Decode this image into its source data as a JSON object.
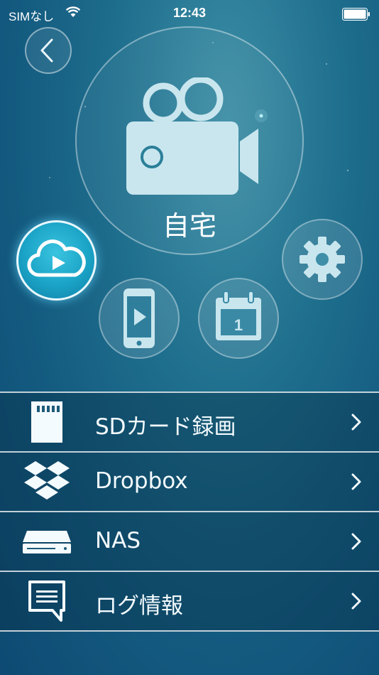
{
  "status_bar": {
    "carrier": "SIMなし",
    "time": "12:43",
    "wifi_icon": "wifi-icon",
    "battery_icon": "battery-icon"
  },
  "header": {
    "back_icon": "chevron-left-icon"
  },
  "camera": {
    "name": "自宅",
    "icon": "video-camera-icon"
  },
  "actions": [
    {
      "id": "cloud-playback",
      "icon": "cloud-play-icon",
      "selected": true
    },
    {
      "id": "settings",
      "icon": "gear-icon",
      "selected": false
    },
    {
      "id": "phone-playback",
      "icon": "phone-play-icon",
      "selected": false
    },
    {
      "id": "schedule",
      "icon": "calendar-icon",
      "calendar_day": "1",
      "selected": false
    }
  ],
  "menu": {
    "items": [
      {
        "label": "SDカード録画",
        "icon": "sd-card-icon"
      },
      {
        "label": "Dropbox",
        "icon": "dropbox-icon"
      },
      {
        "label": "NAS",
        "icon": "nas-drive-icon"
      },
      {
        "label": "ログ情報",
        "icon": "message-log-icon"
      }
    ],
    "chevron_icon": "chevron-right-icon"
  },
  "colors": {
    "background_top": "#3d8fa6",
    "background_bottom": "#0e4a73",
    "accent_cyan": "#1aa3c6",
    "icon_fill": "#c9e6ee"
  }
}
